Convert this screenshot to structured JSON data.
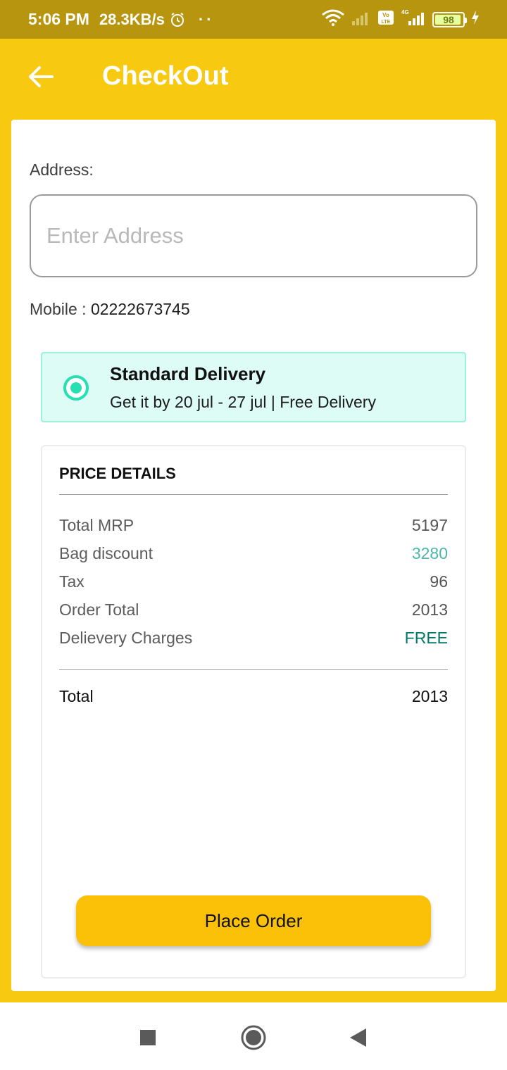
{
  "status_bar": {
    "time": "5:06 PM",
    "speed": "28.3KB/s",
    "dots": "··",
    "battery": "98",
    "icons": [
      "alarm-icon",
      "wifi-icon",
      "signal-icon",
      "volte-icon",
      "4g-signal-icon",
      "battery-icon",
      "charging-icon"
    ]
  },
  "app_bar": {
    "title": "CheckOut",
    "back_icon": "arrow-left-icon"
  },
  "address": {
    "label": "Address:",
    "placeholder": "Enter Address",
    "value": ""
  },
  "mobile": {
    "label": "Mobile :",
    "value": "02222673745"
  },
  "delivery": {
    "title": "Standard Delivery",
    "subtitle": "Get it by 20 jul - 27 jul | Free Delivery",
    "selected": true,
    "accent": "#25e0b0"
  },
  "price_details": {
    "title": "PRICE DETAILS",
    "rows": [
      {
        "label": "Total MRP",
        "value": "5197"
      },
      {
        "label": "Bag discount",
        "value": "3280"
      },
      {
        "label": "Tax",
        "value": "96"
      },
      {
        "label": "Order Total",
        "value": "2013"
      },
      {
        "label": "Delievery Charges",
        "value": "FREE"
      }
    ],
    "total_label": "Total",
    "total_value": "2013"
  },
  "actions": {
    "place_order": "Place Order"
  },
  "colors": {
    "app_bar": "#f7c911",
    "status_bar": "#b8950e",
    "button": "#fbc108",
    "discount": "#4db6ac",
    "free": "#00796b"
  },
  "nav_bar": {
    "icons": [
      "recents-square-icon",
      "home-circle-icon",
      "back-triangle-icon"
    ]
  }
}
